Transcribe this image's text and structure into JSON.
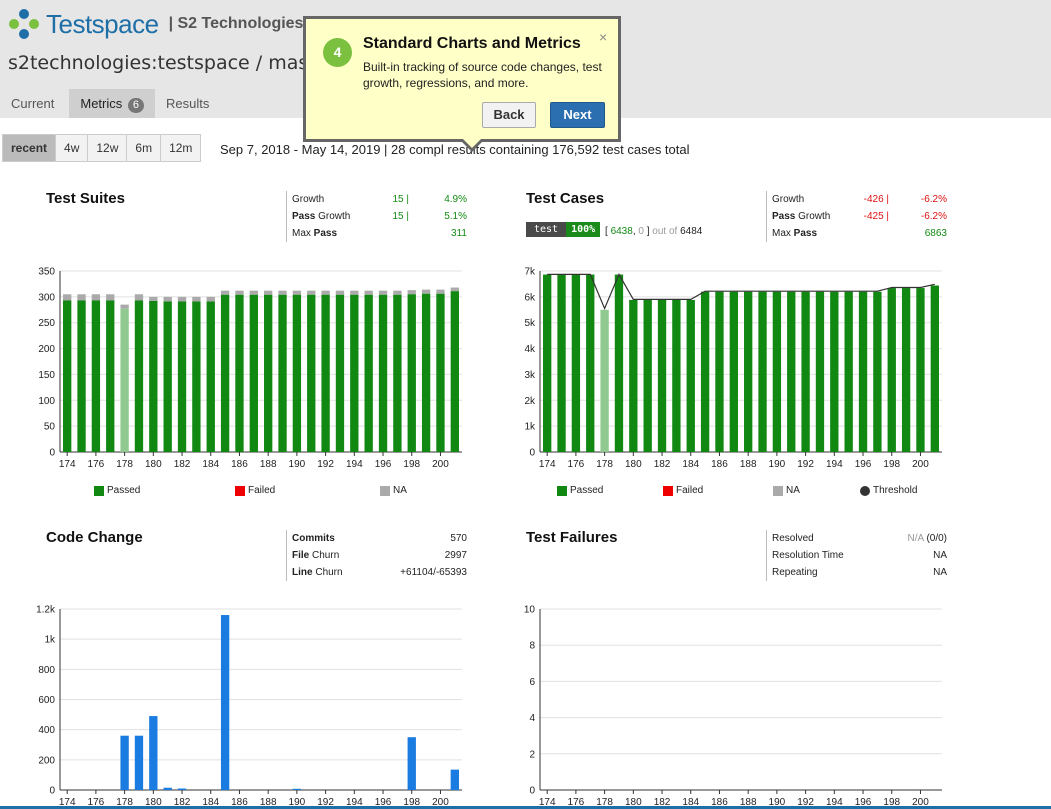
{
  "header": {
    "logo_text": "Testspace",
    "org_label": "| S2 Technologies",
    "project_title": "s2technologies:testspace / maste",
    "tabs": [
      {
        "label": "Current"
      },
      {
        "label": "Metrics",
        "badge": "6"
      },
      {
        "label": "Results"
      }
    ]
  },
  "range": {
    "buttons": [
      "recent",
      "4w",
      "12w",
      "6m",
      "12m"
    ],
    "active": "recent",
    "summary": "Sep 7, 2018 - May 14, 2019 | 28 compl   results containing 176,592 test cases total"
  },
  "popover": {
    "step": "4",
    "title": "Standard Charts and Metrics",
    "body": "Built-in tracking of source code changes, test growth, regressions, and more.",
    "close": "×",
    "back_label": "Back",
    "next_label": "Next"
  },
  "colors": {
    "passed": "#118811",
    "passed_light": "#8fc98f",
    "failed": "#ee0000",
    "na": "#aaaaaa",
    "threshold": "#333333",
    "bar_blue": "#1a7be0"
  },
  "panels": {
    "test_suites": {
      "title": "Test Suites",
      "metrics": [
        {
          "label": "Growth",
          "bold": "",
          "v1": "15 |",
          "v2": "4.9%"
        },
        {
          "label": " Growth",
          "bold": "Pass",
          "v1": "15 |",
          "v2": "5.1%"
        },
        {
          "label": "Max ",
          "bold": "Pass",
          "v1": "",
          "v2": "311"
        }
      ],
      "legend": [
        "Passed",
        "Failed",
        "NA"
      ]
    },
    "test_cases": {
      "title": "Test Cases",
      "pill_name": "test",
      "pill_pct": "100%",
      "pill_pass": "6438",
      "pill_fail": "0",
      "pill_outof": "out of",
      "pill_total": "6484",
      "metrics": [
        {
          "label": "Growth",
          "bold": "",
          "v1": "-426 |",
          "v2": "-6.2%"
        },
        {
          "label": " Growth",
          "bold": "Pass",
          "v1": "-425 |",
          "v2": "-6.2%"
        },
        {
          "label": "Max ",
          "bold": "Pass",
          "v1": "",
          "v2": "6863"
        }
      ],
      "legend": [
        "Passed",
        "Failed",
        "NA",
        "Threshold"
      ]
    },
    "code_change": {
      "title": "Code Change",
      "metrics": [
        {
          "label": "",
          "bold": "Commits",
          "v1": "",
          "v2": "570"
        },
        {
          "label": " Churn",
          "bold": "File",
          "v1": "",
          "v2": "2997"
        },
        {
          "label": " Churn",
          "bold": "Line",
          "v1": "",
          "v2": "+61104/-65393"
        }
      ]
    },
    "test_failures": {
      "title": "Test Failures",
      "metrics": [
        {
          "label": "Resolved",
          "bold": "",
          "v1": "N/A",
          "v2": "(0/0)"
        },
        {
          "label": "Resolution Time",
          "bold": "",
          "v1": "",
          "v2": "NA"
        },
        {
          "label": "Repeating",
          "bold": "",
          "v1": "",
          "v2": "NA"
        }
      ]
    }
  },
  "chart_data": [
    {
      "type": "bar",
      "x": [
        174,
        175,
        176,
        177,
        178,
        179,
        180,
        181,
        182,
        183,
        184,
        185,
        186,
        187,
        188,
        189,
        190,
        191,
        192,
        193,
        194,
        195,
        196,
        197,
        198,
        199,
        200,
        201
      ],
      "tick_labels": [
        "174",
        "176",
        "178",
        "180",
        "182",
        "184",
        "186",
        "188",
        "190",
        "192",
        "194",
        "196",
        "198",
        "200"
      ],
      "series": [
        {
          "name": "Passed",
          "values": [
            293,
            293,
            293,
            293,
            277,
            293,
            292,
            291,
            291,
            291,
            291,
            304,
            304,
            304,
            304,
            304,
            304,
            304,
            304,
            304,
            304,
            304,
            304,
            304,
            305,
            306,
            306,
            311
          ]
        },
        {
          "name": "NA",
          "values": [
            305,
            305,
            305,
            305,
            285,
            305,
            300,
            300,
            300,
            300,
            300,
            312,
            312,
            312,
            312,
            312,
            312,
            312,
            312,
            312,
            312,
            312,
            312,
            312,
            313,
            314,
            314,
            318
          ]
        }
      ],
      "yticks": [
        "0",
        "50",
        "100",
        "150",
        "200",
        "250",
        "300",
        "350"
      ],
      "ylim": [
        0,
        350
      ]
    },
    {
      "type": "bar",
      "x": [
        174,
        175,
        176,
        177,
        178,
        179,
        180,
        181,
        182,
        183,
        184,
        185,
        186,
        187,
        188,
        189,
        190,
        191,
        192,
        193,
        194,
        195,
        196,
        197,
        198,
        199,
        200,
        201
      ],
      "tick_labels": [
        "174",
        "176",
        "178",
        "180",
        "182",
        "184",
        "186",
        "188",
        "190",
        "192",
        "194",
        "196",
        "198",
        "200"
      ],
      "series": [
        {
          "name": "Passed",
          "values": [
            6863,
            6863,
            6863,
            6863,
            5500,
            6863,
            5880,
            5880,
            5880,
            5880,
            5880,
            6200,
            6200,
            6200,
            6200,
            6200,
            6200,
            6200,
            6200,
            6200,
            6200,
            6200,
            6200,
            6200,
            6340,
            6340,
            6340,
            6438
          ]
        },
        {
          "name": "Threshold",
          "values": [
            6870,
            6870,
            6870,
            6870,
            5550,
            6870,
            5900,
            5900,
            5900,
            5900,
            5900,
            6220,
            6220,
            6220,
            6220,
            6220,
            6220,
            6220,
            6220,
            6220,
            6220,
            6220,
            6220,
            6220,
            6360,
            6360,
            6360,
            6484
          ]
        }
      ],
      "yticks": [
        "0",
        "1k",
        "2k",
        "3k",
        "4k",
        "5k",
        "6k",
        "7k"
      ],
      "ylim": [
        0,
        7000
      ]
    },
    {
      "type": "bar",
      "x": [
        174,
        175,
        176,
        177,
        178,
        179,
        180,
        181,
        182,
        183,
        184,
        185,
        186,
        187,
        188,
        189,
        190,
        191,
        192,
        193,
        194,
        195,
        196,
        197,
        198,
        199,
        200,
        201
      ],
      "tick_labels": [
        "174",
        "176",
        "178",
        "180",
        "182",
        "184",
        "186",
        "188",
        "190",
        "192",
        "194",
        "196",
        "198",
        "200"
      ],
      "values": [
        0,
        0,
        0,
        0,
        360,
        360,
        490,
        15,
        10,
        0,
        0,
        1160,
        0,
        0,
        0,
        0,
        8,
        0,
        0,
        0,
        0,
        0,
        0,
        0,
        350,
        0,
        0,
        135
      ],
      "yticks": [
        "0",
        "200",
        "400",
        "600",
        "800",
        "1k",
        "1.2k"
      ],
      "ylim": [
        0,
        1200
      ]
    },
    {
      "type": "bar",
      "x": [
        174,
        175,
        176,
        177,
        178,
        179,
        180,
        181,
        182,
        183,
        184,
        185,
        186,
        187,
        188,
        189,
        190,
        191,
        192,
        193,
        194,
        195,
        196,
        197,
        198,
        199,
        200,
        201
      ],
      "tick_labels": [
        "174",
        "176",
        "178",
        "180",
        "182",
        "184",
        "186",
        "188",
        "190",
        "192",
        "194",
        "196",
        "198",
        "200"
      ],
      "values": [],
      "yticks": [
        "0",
        "2",
        "4",
        "6",
        "8",
        "10"
      ],
      "ylim": [
        0,
        10
      ]
    }
  ]
}
